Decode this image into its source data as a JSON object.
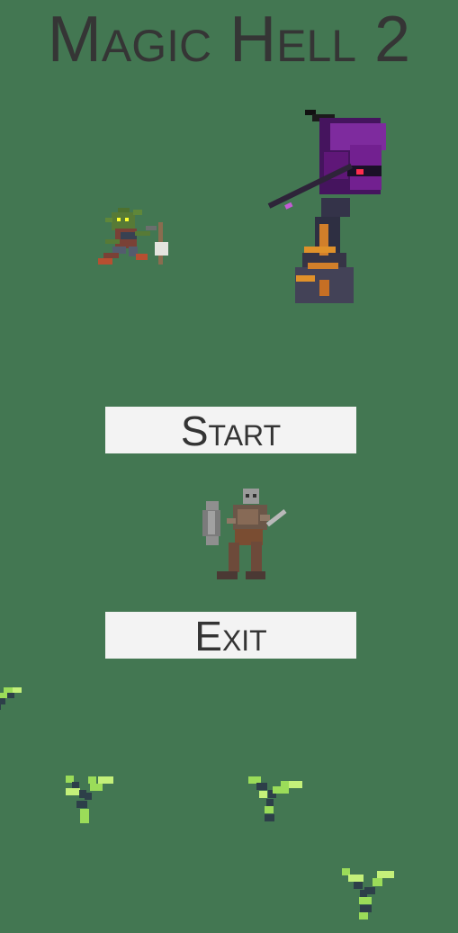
{
  "title": "Magic Hell 2",
  "menu": {
    "start_label": "Start",
    "exit_label": "Exit"
  },
  "sprites": [
    "goblin",
    "dark-mage",
    "skeleton-warrior"
  ],
  "decorations": [
    "grass-sprout",
    "grass-sprout",
    "grass-sprout",
    "grass-sprout"
  ],
  "colors": {
    "background": "#437752",
    "button": "#f3f3f3",
    "text": "#353535",
    "grass_light": "#9bdc59",
    "grass_dark": "#2d3f49"
  }
}
